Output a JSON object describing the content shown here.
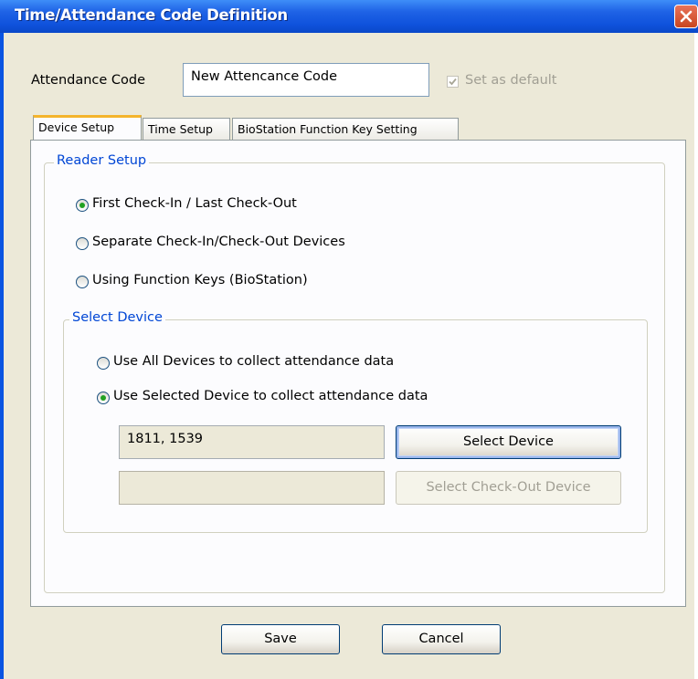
{
  "window": {
    "title": "Time/Attendance Code Definition"
  },
  "form": {
    "attendance_code_label": "Attendance Code",
    "attendance_code_value": "New Attencance Code",
    "set_as_default_label": "Set as default",
    "set_as_default_checked": true
  },
  "tabs": [
    {
      "label": "Device Setup",
      "active": true
    },
    {
      "label": "Time Setup",
      "active": false
    },
    {
      "label": "BioStation Function Key Setting",
      "active": false
    }
  ],
  "reader_setup": {
    "legend": "Reader Setup",
    "options": [
      {
        "label": "First Check-In / Last Check-Out",
        "selected": true
      },
      {
        "label": "Separate Check-In/Check-Out Devices",
        "selected": false
      },
      {
        "label": "Using Function Keys (BioStation)",
        "selected": false
      }
    ]
  },
  "select_device": {
    "legend": "Select Device",
    "options": [
      {
        "label": "Use All Devices to collect attendance data",
        "selected": false
      },
      {
        "label": "Use Selected Device to collect attendance data",
        "selected": true
      }
    ],
    "device_list_value": "1811, 1539",
    "checkout_device_value": "",
    "select_device_button": "Select Device",
    "select_checkout_button": "Select Check-Out Device"
  },
  "footer": {
    "save_label": "Save",
    "cancel_label": "Cancel"
  },
  "colors": {
    "title_bar": "#0f52dc",
    "group_legend": "#0046d5",
    "radio_selected": "#21a121",
    "dialog_bg": "#ece9d8"
  },
  "icons": {
    "close": "close-icon",
    "checkbox": "checkmark-icon"
  }
}
